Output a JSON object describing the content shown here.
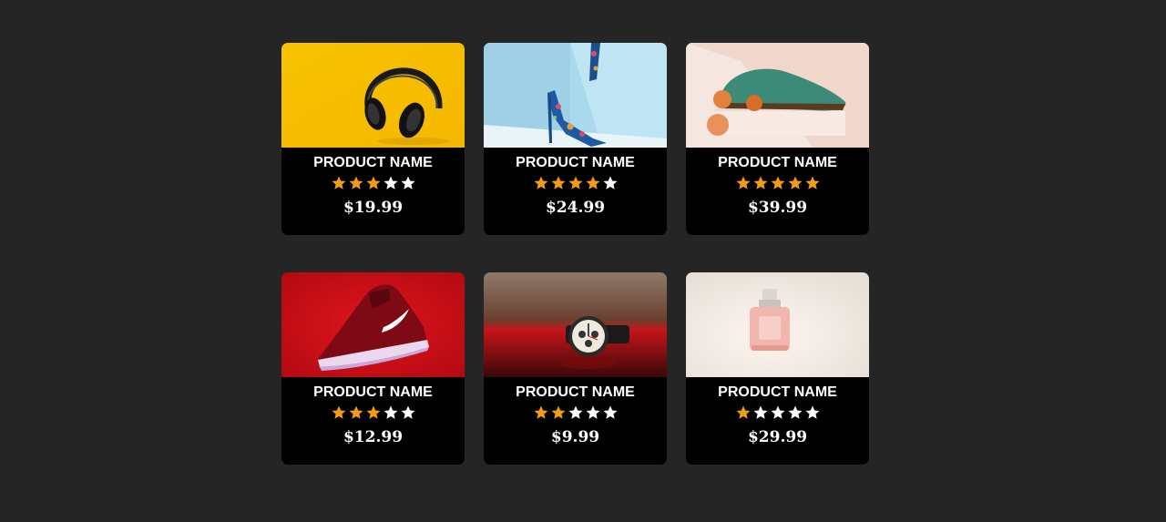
{
  "colors": {
    "page_background": "#252525",
    "card_background": "#000000",
    "star_filled": "#f39c12",
    "star_empty": "#ffffff",
    "text": "#ffffff"
  },
  "products": [
    {
      "name": "PRODUCT NAME",
      "rating": 3,
      "max_rating": 5,
      "price": "$19.99",
      "image": "headphones-photo"
    },
    {
      "name": "PRODUCT NAME",
      "rating": 4,
      "max_rating": 5,
      "price": "$24.99",
      "image": "high-heels-photo"
    },
    {
      "name": "PRODUCT NAME",
      "rating": 5,
      "max_rating": 5,
      "price": "$39.99",
      "image": "green-shoe-photo"
    },
    {
      "name": "PRODUCT NAME",
      "rating": 3,
      "max_rating": 5,
      "price": "$12.99",
      "image": "red-sneaker-photo"
    },
    {
      "name": "PRODUCT NAME",
      "rating": 2,
      "max_rating": 5,
      "price": "$9.99",
      "image": "watch-photo"
    },
    {
      "name": "PRODUCT NAME",
      "rating": 1,
      "max_rating": 5,
      "price": "$29.99",
      "image": "perfume-photo"
    }
  ]
}
